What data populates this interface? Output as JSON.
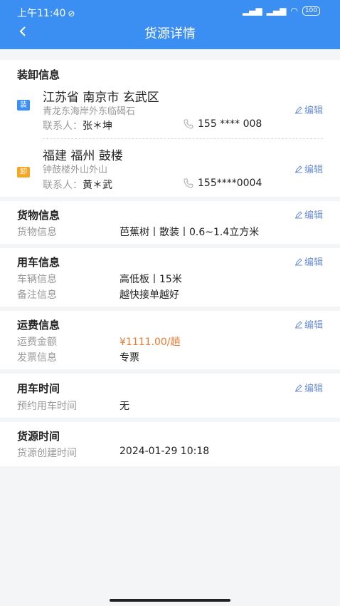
{
  "status_bar": {
    "time": "上午11:40",
    "battery": "100"
  },
  "header": {
    "title": "货源详情"
  },
  "load_unload": {
    "title": "装卸信息",
    "edit_label": "编辑",
    "load": {
      "badge": "装",
      "address": "江苏省 南京市 玄武区",
      "detail": "青龙东海岸外东临碣石",
      "contact_label": "联系人：",
      "contact_name": "张＊坤",
      "phone": "155 **** 008"
    },
    "unload": {
      "badge": "卸",
      "address": "福建 福州 鼓楼",
      "detail": "钟鼓楼外山外山",
      "contact_label": "联系人：",
      "contact_name": "黄＊武",
      "phone": "155****0004"
    }
  },
  "cargo": {
    "title": "货物信息",
    "edit_label": "编辑",
    "rows": [
      {
        "label": "货物信息",
        "value": "芭蕉树丨散装丨0.6~1.4立方米"
      }
    ]
  },
  "vehicle": {
    "title": "用车信息",
    "edit_label": "编辑",
    "rows": [
      {
        "label": "车辆信息",
        "value": "高低板丨15米"
      },
      {
        "label": "备注信息",
        "value": "越快接单越好"
      }
    ]
  },
  "freight": {
    "title": "运费信息",
    "edit_label": "编辑",
    "rows": [
      {
        "label": "运费金额",
        "value": "¥1111.00/趟"
      },
      {
        "label": "发票信息",
        "value": "专票"
      }
    ]
  },
  "use_time": {
    "title": "用车时间",
    "edit_label": "编辑",
    "rows": [
      {
        "label": "预约用车时间",
        "value": "无"
      }
    ]
  },
  "source_time": {
    "title": "货源时间",
    "rows": [
      {
        "label": "货源创建时间",
        "value": "2024-01-29 10:18"
      }
    ]
  },
  "colors": {
    "header": "#3b8ef2",
    "accent_link": "#6b8ed6",
    "price": "#f07a2e",
    "load_badge": "#3b8ef2",
    "unload_badge": "#f5a623"
  }
}
